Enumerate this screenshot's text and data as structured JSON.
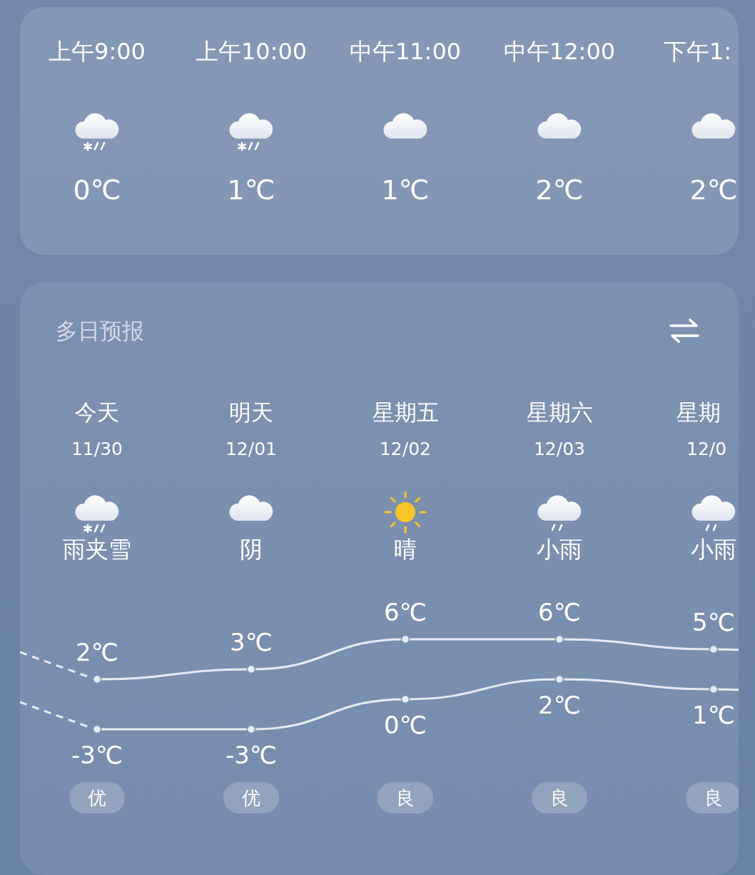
{
  "hourly": [
    {
      "time": "上午9:00",
      "kind": "sleet",
      "temp": "0℃"
    },
    {
      "time": "上午10:00",
      "kind": "sleet",
      "temp": "1℃"
    },
    {
      "time": "中午11:00",
      "kind": "cloudy",
      "temp": "1℃"
    },
    {
      "time": "中午12:00",
      "kind": "cloudy",
      "temp": "2℃"
    },
    {
      "time": "下午1:",
      "kind": "cloudy",
      "temp": "2℃"
    }
  ],
  "forecast": {
    "title": "多日预报",
    "days": [
      {
        "name": "今天",
        "date": "11/30",
        "kind": "sleet",
        "condition": "雨夹雪",
        "high": "2℃",
        "low": "-3℃",
        "aqi": "优"
      },
      {
        "name": "明天",
        "date": "12/01",
        "kind": "cloudy",
        "condition": "阴",
        "high": "3℃",
        "low": "-3℃",
        "aqi": "优"
      },
      {
        "name": "星期五",
        "date": "12/02",
        "kind": "sunny",
        "condition": "晴",
        "high": "6℃",
        "low": "0℃",
        "aqi": "良"
      },
      {
        "name": "星期六",
        "date": "12/03",
        "kind": "rain",
        "condition": "小雨",
        "high": "6℃",
        "low": "2℃",
        "aqi": "良"
      },
      {
        "name": "星期",
        "date": "12/0",
        "kind": "rain",
        "condition": "小雨",
        "high": "5℃",
        "low": "1℃",
        "aqi": "良"
      }
    ]
  }
}
